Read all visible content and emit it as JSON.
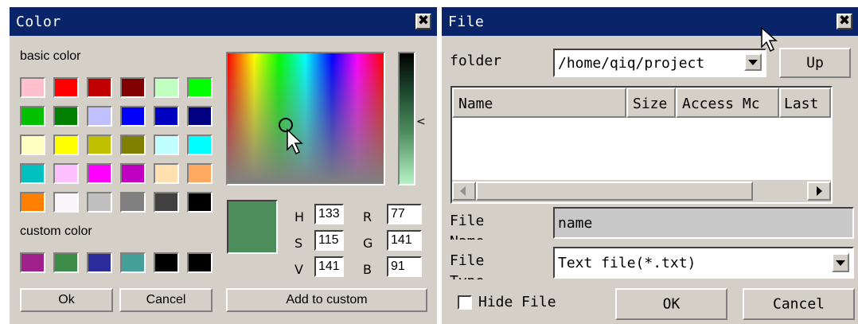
{
  "color_dialog": {
    "title": "Color",
    "close_glyph": "✖",
    "basic_color_label": "basic color",
    "custom_color_label": "custom color",
    "basic_colors": [
      "#ffc0cb",
      "#ff0000",
      "#c00000",
      "#800000",
      "#c0ffc0",
      "#00ff00",
      "#00c000",
      "#008000",
      "#c0c0ff",
      "#0000ff",
      "#0000c0",
      "#000080",
      "#ffffc0",
      "#ffff00",
      "#c0c000",
      "#808000",
      "#c0ffff",
      "#00ffff",
      "#00c0c0",
      "#ffc0ff",
      "#ff00ff",
      "#c000c0",
      "#ffe0b0",
      "#ffa860",
      "#ff8000",
      "#f8f4f8",
      "#c0c0c0",
      "#808080",
      "#404040",
      "#000000"
    ],
    "custom_colors": [
      "#a0208c",
      "#3c8c48",
      "#2c2c9c",
      "#44a098",
      "#000000",
      "#000000"
    ],
    "current_color": "#4d8c5b",
    "fields": [
      {
        "label": "H",
        "value": "133"
      },
      {
        "label": "S",
        "value": "115"
      },
      {
        "label": "V",
        "value": "141"
      },
      {
        "label": "R",
        "value": "77"
      },
      {
        "label": "G",
        "value": "141"
      },
      {
        "label": "B",
        "value": "91"
      }
    ],
    "ok_label": "Ok",
    "cancel_label": "Cancel",
    "add_custom_label": "Add to custom",
    "lum_arrow": "<"
  },
  "file_dialog": {
    "title": "File",
    "close_glyph": "✖",
    "folder_label": "folder",
    "folder_value": "/home/qiq/project",
    "up_label": "Up",
    "columns": [
      "Name",
      "Size",
      "Access Mc",
      "Last"
    ],
    "file_name_label": "File Name",
    "file_name_value": "name",
    "file_type_label": "File Type",
    "file_type_value": "Text file(*.txt)",
    "hide_file_label": "Hide File",
    "ok_label": "OK",
    "cancel_label": "Cancel"
  }
}
